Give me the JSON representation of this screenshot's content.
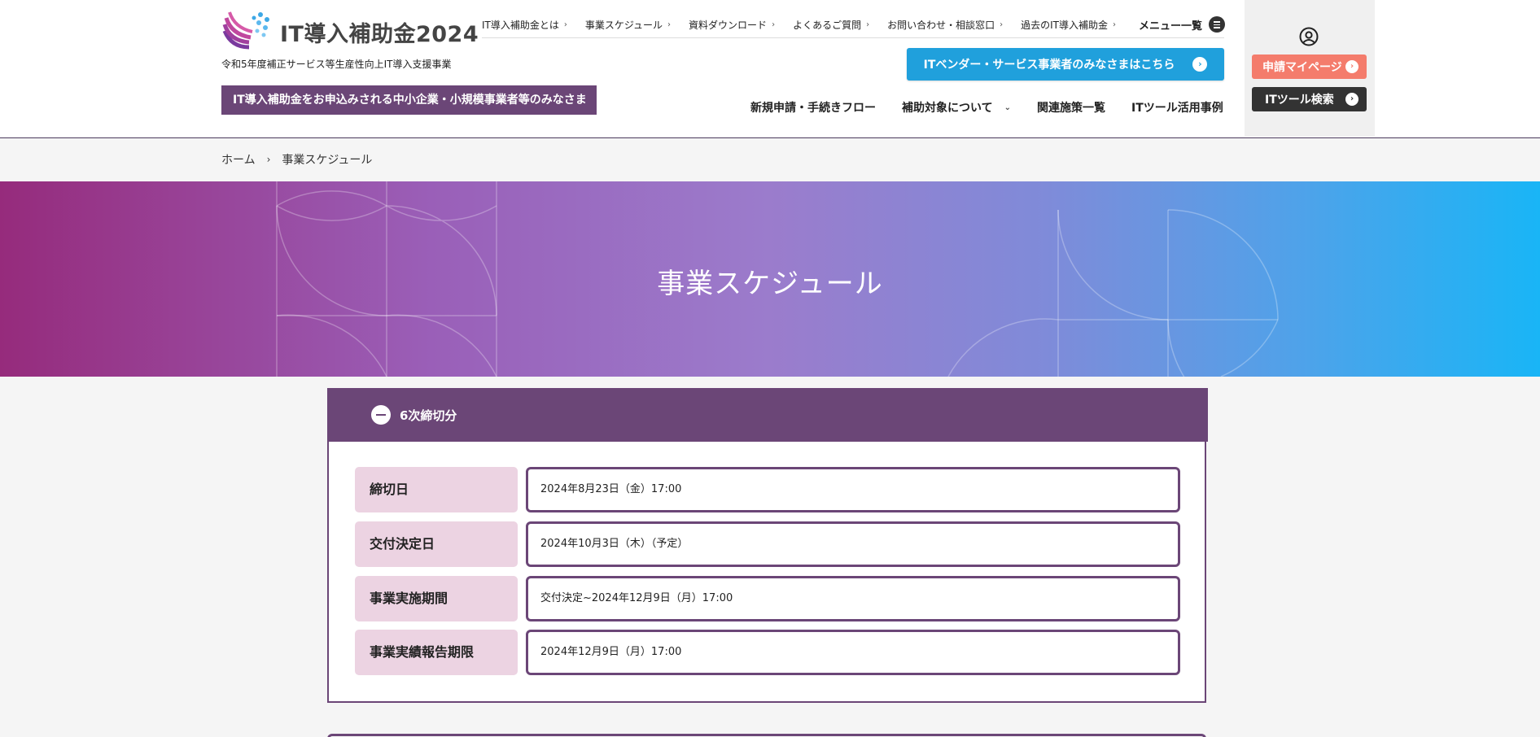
{
  "header": {
    "logo_text": "IT導入補助金2024",
    "subtitle": "令和5年度補正サービス等生産性向上IT導入支援事業",
    "sme_banner": "IT導入補助金をお申込みされる中小企業・小規模事業者等のみなさま"
  },
  "topnav": {
    "items": [
      {
        "label": "IT導入補助金とは"
      },
      {
        "label": "事業スケジュール"
      },
      {
        "label": "資料ダウンロード"
      },
      {
        "label": "よくあるご質問"
      },
      {
        "label": "お問い合わせ・相談窓口"
      },
      {
        "label": "過去のIT導入補助金"
      }
    ],
    "menu_all": "メニュー一覧"
  },
  "vendor_button": "ITベンダー・サービス事業者のみなさまはこちら",
  "mainnav": {
    "items": [
      {
        "label": "新規申請・手続きフロー"
      },
      {
        "label": "補助対象について"
      },
      {
        "label": "関連施策一覧"
      },
      {
        "label": "ITツール活用事例"
      }
    ]
  },
  "side": {
    "mypage": "申請マイページ",
    "tool_search": "ITツール検索"
  },
  "breadcrumb": {
    "home": "ホーム",
    "current": "事業スケジュール"
  },
  "hero": {
    "title": "事業スケジュール"
  },
  "schedule": {
    "heading": "6次締切分",
    "rows": [
      {
        "key": "締切日",
        "value": "2024年8月23日（金）17:00"
      },
      {
        "key": "交付決定日",
        "value": "2024年10月3日（木）（予定）"
      },
      {
        "key": "事業実施期間",
        "value": "交付決定~2024年12月9日（月）17:00"
      },
      {
        "key": "事業実績報告期限",
        "value": "2024年12月9日（月）17:00"
      }
    ]
  },
  "colors": {
    "brand_purple": "#6b4677",
    "vendor_blue": "#20a0dc",
    "mypage_coral": "#f47c6c",
    "key_pink": "#ecd3e2"
  }
}
